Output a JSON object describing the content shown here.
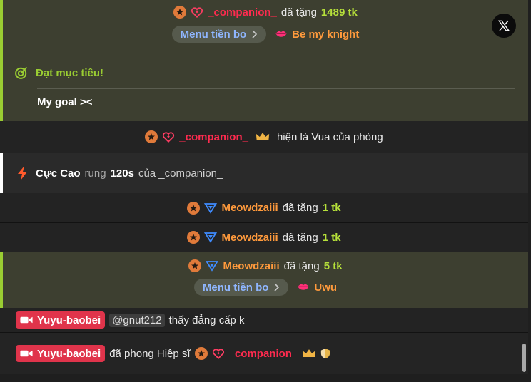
{
  "gift1": {
    "user": "_companion_",
    "action": "đã tặng",
    "amount": "1489 tk",
    "menu_label": "Menu tiền bo",
    "item": "Be my knight"
  },
  "goal": {
    "title": "Đạt mục tiêu!",
    "text": "My goal ><"
  },
  "king": {
    "user": "_companion_",
    "text": "hiện là Vua của phòng"
  },
  "vibe": {
    "name": "Cực Cao",
    "mid": "rung",
    "duration": "120s",
    "tail": "của _companion_"
  },
  "gift2": {
    "user": "Meowdzaiii",
    "action": "đã tặng",
    "amount": "1 tk"
  },
  "gift3": {
    "user": "Meowdzaiii",
    "action": "đã tặng",
    "amount": "1 tk"
  },
  "gift4": {
    "user": "Meowdzaiii",
    "action": "đã tặng",
    "amount": "5 tk",
    "menu_label": "Menu tiền bo",
    "item": "Uwu"
  },
  "msg1": {
    "host": "Yuyu-baobei",
    "mention": "@gnut212",
    "text": "thấy đẳng cấp k"
  },
  "msg2": {
    "host": "Yuyu-baobei",
    "text": "đã phong Hiệp sĩ",
    "user": "_companion_"
  },
  "colors": {
    "accent_green": "#9acd32",
    "red_name": "#ff2b4f",
    "orange_name": "#ff9a3c",
    "tag_red": "#e0344b"
  },
  "icons": [
    "star-badge-icon",
    "heart-diamond-icon",
    "kiss-lips-icon",
    "target-icon",
    "crown-icon",
    "lightning-icon",
    "triangle-badge-icon",
    "camera-icon",
    "shield-icon",
    "x-logo-icon",
    "chevron-right-icon"
  ]
}
